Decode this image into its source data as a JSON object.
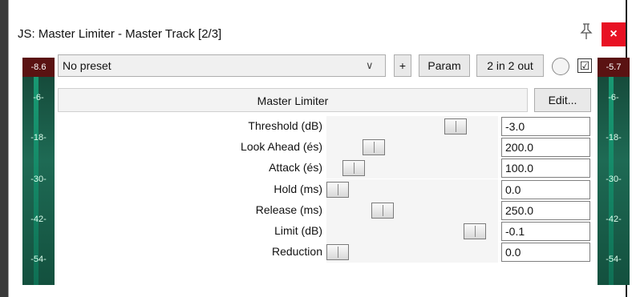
{
  "window": {
    "title": "JS: Master Limiter - Master Track [2/3]",
    "close_label": "×"
  },
  "toolbar": {
    "preset": "No preset",
    "plus_label": "+",
    "param_label": "Param",
    "routing_label": "2 in 2 out",
    "enabled_check": "☑"
  },
  "meters": {
    "left_peak": "-8.6",
    "right_peak": "-5.7",
    "scale": [
      "-6-",
      "-18-",
      "-30-",
      "-42-",
      "-54-"
    ]
  },
  "plugin": {
    "name": "Master Limiter",
    "edit_label": "Edit..."
  },
  "params": [
    {
      "label": "Threshold (dB)",
      "value": "-3.0",
      "level": 0.79
    },
    {
      "label": "Look Ahead (és)",
      "value": "200.0",
      "level": 0.24
    },
    {
      "label": "Attack (és)",
      "value": "100.0",
      "level": 0.11
    },
    {
      "label": "Hold (ms)",
      "value": "0.0",
      "level": 0.0
    },
    {
      "label": "Release (ms)",
      "value": "250.0",
      "level": 0.3
    },
    {
      "label": "Limit (dB)",
      "value": "-0.1",
      "level": 0.92
    },
    {
      "label": "Reduction",
      "value": "0.0",
      "level": 0.0
    }
  ],
  "colors": {
    "close_bg": "#e81123",
    "meter_green": "#1e6a54",
    "peak_red": "#5a1212"
  }
}
